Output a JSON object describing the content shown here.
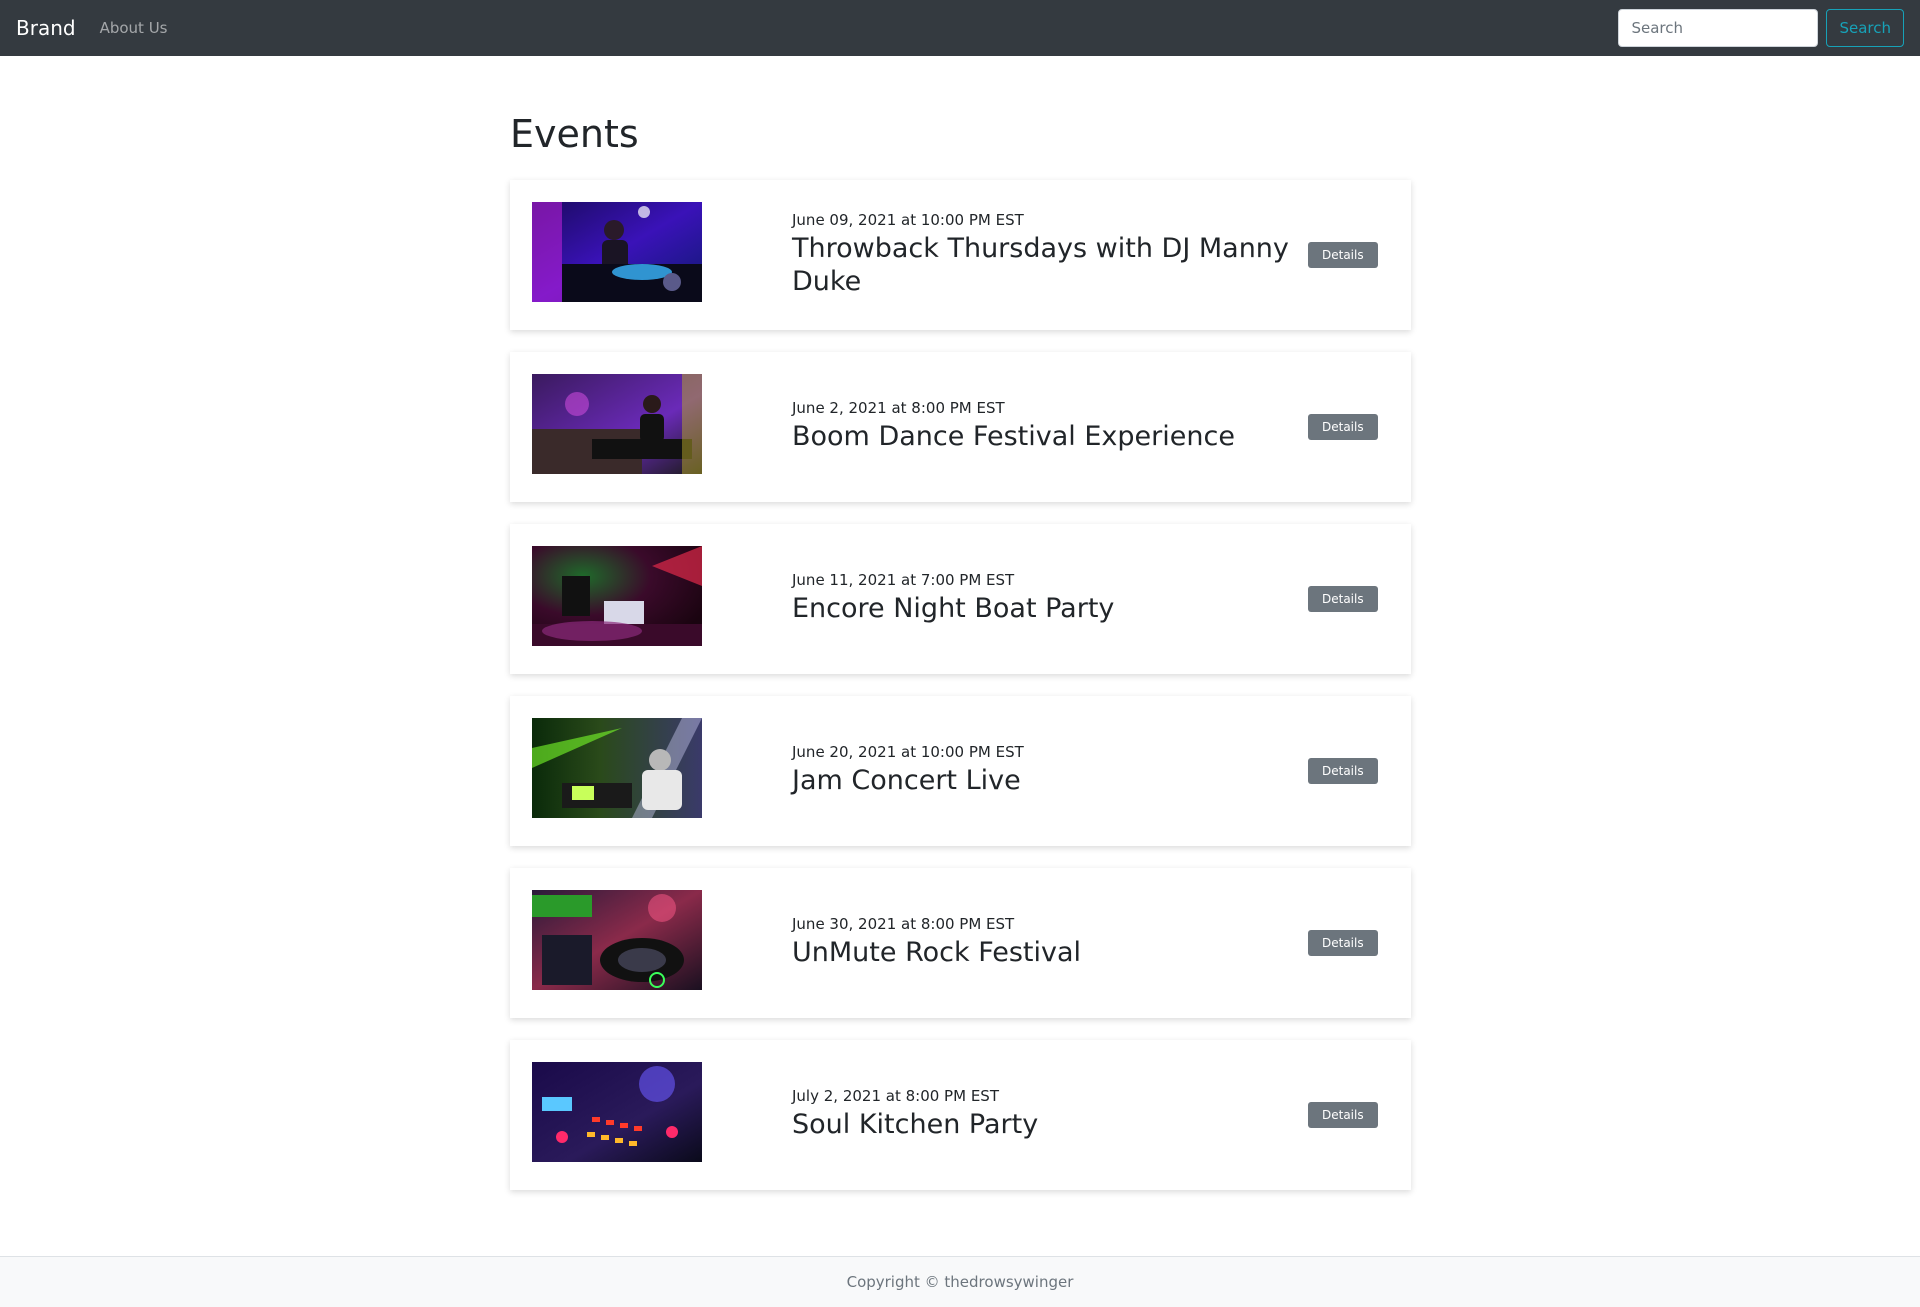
{
  "navbar": {
    "brand": "Brand",
    "links": [
      "About Us"
    ],
    "search": {
      "placeholder": "Search",
      "button_label": "Search"
    }
  },
  "main": {
    "title": "Events",
    "events": [
      {
        "date": "June 09, 2021 at 10:00 PM EST",
        "title": "Throwback Thursdays with DJ Manny Duke",
        "button_label": "Details"
      },
      {
        "date": "June 2, 2021 at 8:00 PM EST",
        "title": "Boom Dance Festival Experience",
        "button_label": "Details"
      },
      {
        "date": "June 11, 2021 at 7:00 PM EST",
        "title": "Encore Night Boat Party",
        "button_label": "Details"
      },
      {
        "date": "June 20, 2021 at 10:00 PM EST",
        "title": "Jam Concert Live",
        "button_label": "Details"
      },
      {
        "date": "June 30, 2021 at 8:00 PM EST",
        "title": "UnMute Rock Festival",
        "button_label": "Details"
      },
      {
        "date": "July 2, 2021 at 8:00 PM EST",
        "title": "Soul Kitchen Party",
        "button_label": "Details"
      }
    ]
  },
  "footer": {
    "text": "Copyright © thedrowsywinger"
  },
  "colors": {
    "navbar_bg": "#343a40",
    "search_accent": "#17a2b8",
    "details_button_bg": "#6c757d",
    "footer_bg": "#f8f9fa"
  }
}
